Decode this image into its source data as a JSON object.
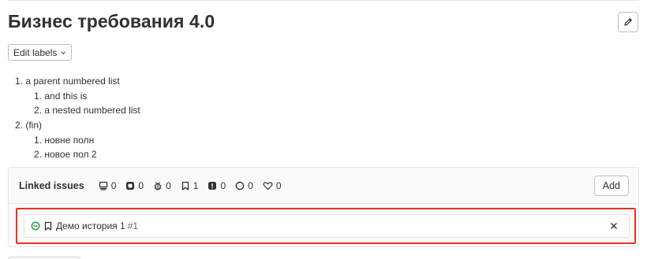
{
  "issue": {
    "title": "Бизнес требования 4.0"
  },
  "labels": {
    "button_label": "Edit labels"
  },
  "description": {
    "lines": [
      "1. a parent numbered list",
      "1. and this is",
      "2. a nested numbered list",
      "2. (fin)",
      "1. новне полн",
      "2. новое пол 2"
    ]
  },
  "linked_issues": {
    "title": "Linked issues",
    "counts": {
      "requirement": "0",
      "test_case": "0",
      "bug": "0",
      "user_story": "1",
      "issue": "0",
      "incident": "0",
      "feature": "0"
    },
    "add_label": "Add",
    "items": [
      {
        "title": "Демо история 1",
        "ref": "#1",
        "status_icon": "issue-open-icon",
        "type_icon": "bookmark-icon"
      }
    ]
  },
  "colors": {
    "highlight": "#e8351f",
    "status_open": "#2d9d4b"
  }
}
